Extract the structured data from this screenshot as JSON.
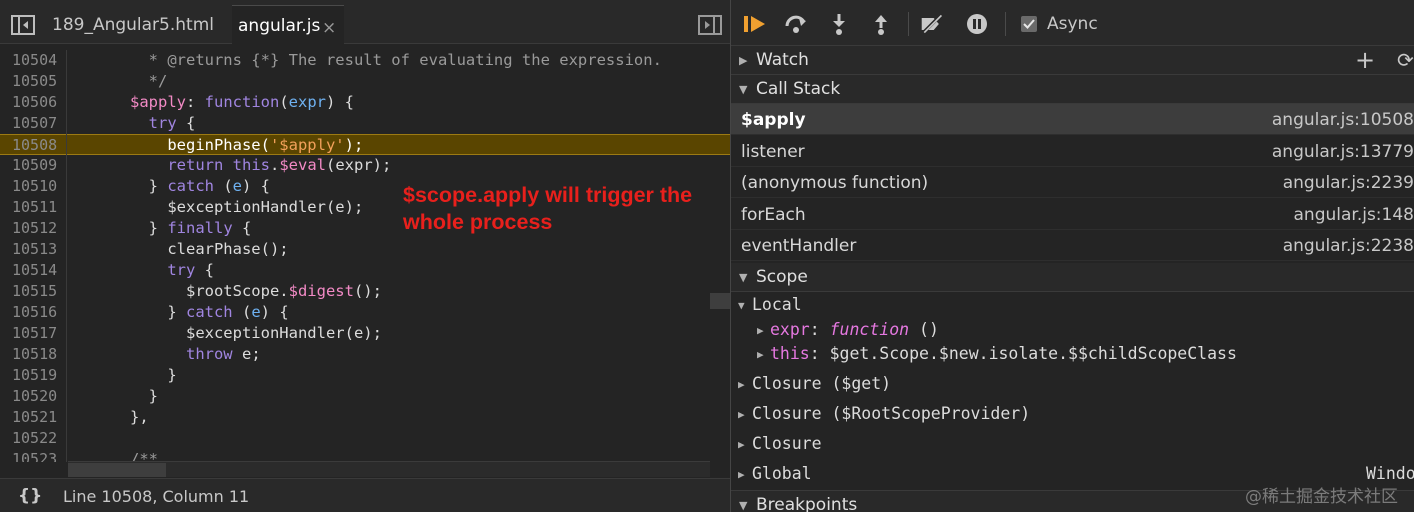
{
  "editor": {
    "tabs": [
      {
        "label": "189_Angular5.html"
      },
      {
        "label": "angular.js",
        "close": "×"
      }
    ],
    "lines": [
      {
        "num": "10504",
        "segs": [
          {
            "t": "        * @returns {*} The result of evaluating the expression.",
            "c": "c"
          }
        ]
      },
      {
        "num": "10505",
        "segs": [
          {
            "t": "        */",
            "c": "c"
          }
        ]
      },
      {
        "num": "10506",
        "segs": [
          {
            "t": "      ",
            "c": ""
          },
          {
            "t": "$apply",
            "c": "p"
          },
          {
            "t": ": ",
            "c": ""
          },
          {
            "t": "function",
            "c": "k"
          },
          {
            "t": "(",
            "c": ""
          },
          {
            "t": "expr",
            "c": "v"
          },
          {
            "t": ") {",
            "c": ""
          }
        ]
      },
      {
        "num": "10507",
        "segs": [
          {
            "t": "        ",
            "c": ""
          },
          {
            "t": "try",
            "c": "k"
          },
          {
            "t": " {",
            "c": ""
          }
        ]
      },
      {
        "num": "10508",
        "hl": true,
        "segs": [
          {
            "t": "          beginPhase(",
            "c": "t"
          },
          {
            "t": "'$apply'",
            "c": "s"
          },
          {
            "t": ");",
            "c": "t"
          }
        ]
      },
      {
        "num": "10509",
        "segs": [
          {
            "t": "          ",
            "c": ""
          },
          {
            "t": "return",
            "c": "k"
          },
          {
            "t": " ",
            "c": ""
          },
          {
            "t": "this",
            "c": "k"
          },
          {
            "t": ".",
            "c": ""
          },
          {
            "t": "$eval",
            "c": "p"
          },
          {
            "t": "(expr);",
            "c": ""
          }
        ]
      },
      {
        "num": "10510",
        "segs": [
          {
            "t": "        } ",
            "c": ""
          },
          {
            "t": "catch",
            "c": "k"
          },
          {
            "t": " (",
            "c": ""
          },
          {
            "t": "e",
            "c": "v"
          },
          {
            "t": ") {",
            "c": ""
          }
        ]
      },
      {
        "num": "10511",
        "segs": [
          {
            "t": "          $exceptionHandler(e);",
            "c": ""
          }
        ]
      },
      {
        "num": "10512",
        "segs": [
          {
            "t": "        } ",
            "c": ""
          },
          {
            "t": "finally",
            "c": "k"
          },
          {
            "t": " {",
            "c": ""
          }
        ]
      },
      {
        "num": "10513",
        "segs": [
          {
            "t": "          clearPhase();",
            "c": ""
          }
        ]
      },
      {
        "num": "10514",
        "segs": [
          {
            "t": "          ",
            "c": ""
          },
          {
            "t": "try",
            "c": "k"
          },
          {
            "t": " {",
            "c": ""
          }
        ]
      },
      {
        "num": "10515",
        "segs": [
          {
            "t": "            $rootScope.",
            "c": ""
          },
          {
            "t": "$digest",
            "c": "p"
          },
          {
            "t": "();",
            "c": ""
          }
        ]
      },
      {
        "num": "10516",
        "segs": [
          {
            "t": "          } ",
            "c": ""
          },
          {
            "t": "catch",
            "c": "k"
          },
          {
            "t": " (",
            "c": ""
          },
          {
            "t": "e",
            "c": "v"
          },
          {
            "t": ") {",
            "c": ""
          }
        ]
      },
      {
        "num": "10517",
        "segs": [
          {
            "t": "            $exceptionHandler(e);",
            "c": ""
          }
        ]
      },
      {
        "num": "10518",
        "segs": [
          {
            "t": "            ",
            "c": ""
          },
          {
            "t": "throw",
            "c": "k"
          },
          {
            "t": " e;",
            "c": ""
          }
        ]
      },
      {
        "num": "10519",
        "segs": [
          {
            "t": "          }",
            "c": ""
          }
        ]
      },
      {
        "num": "10520",
        "segs": [
          {
            "t": "        }",
            "c": ""
          }
        ]
      },
      {
        "num": "10521",
        "segs": [
          {
            "t": "      },",
            "c": ""
          }
        ]
      },
      {
        "num": "10522",
        "segs": [
          {
            "t": "",
            "c": ""
          }
        ]
      },
      {
        "num": "10523",
        "segs": [
          {
            "t": "      /**",
            "c": "c"
          }
        ]
      }
    ],
    "annotation": [
      "$scope.apply will trigger the",
      "whole process"
    ],
    "status": {
      "pretty_print": "{}",
      "cursor": "Line 10508, Column 11"
    }
  },
  "debugger": {
    "async_label": "Async",
    "async_checked": true,
    "sections": {
      "watch": "Watch",
      "call_stack": "Call Stack",
      "scope": "Scope",
      "breakpoints": "Breakpoints"
    },
    "watch_add": "+",
    "watch_refresh": "⟳",
    "frames": [
      {
        "name": "$apply",
        "loc": "angular.js:10508",
        "selected": true
      },
      {
        "name": "listener",
        "loc": "angular.js:13779"
      },
      {
        "name": "(anonymous function)",
        "loc": "angular.js:2239"
      },
      {
        "name": "forEach",
        "loc": "angular.js:148"
      },
      {
        "name": "eventHandler",
        "loc": "angular.js:2238"
      }
    ],
    "scope": {
      "local": "Local",
      "local_items": [
        {
          "key": "expr",
          "sep": ": ",
          "fn": "function",
          "rest": " ()"
        },
        {
          "key": "this",
          "sep": ": ",
          "fn": "",
          "rest": "$get.Scope.$new.isolate.$$childScopeClass"
        }
      ],
      "closures": [
        "Closure ($get)",
        "Closure ($RootScopeProvider)",
        "Closure"
      ],
      "global": "Global",
      "global_value": "Window"
    }
  },
  "watermark": "@稀土掘金技术社区",
  "colors": {
    "highlight": "#5a4500",
    "annotation": "#e8201c",
    "keyword": "#a085e0",
    "string": "#f2a15a"
  }
}
